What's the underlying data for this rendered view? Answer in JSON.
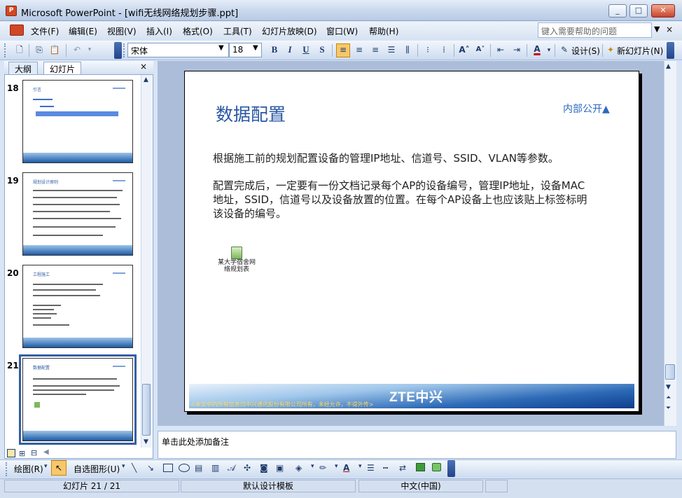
{
  "window": {
    "title": "Microsoft PowerPoint - [wifi无线网络规划步骤.ppt]",
    "minimize": "_",
    "maximize": "□",
    "close": "✕"
  },
  "menu": {
    "items": [
      "文件(F)",
      "编辑(E)",
      "视图(V)",
      "插入(I)",
      "格式(O)",
      "工具(T)",
      "幻灯片放映(D)",
      "窗口(W)",
      "帮助(H)"
    ],
    "help_placeholder": "键入需要帮助的问题",
    "close": "×"
  },
  "toolbar": {
    "font": "宋体",
    "size": "18",
    "bold": "B",
    "italic": "I",
    "underline": "U",
    "shadow": "S",
    "font_color": "A",
    "design_label": "设计(S)",
    "new_slide_label": "新幻灯片(N)"
  },
  "left_pane": {
    "tabs": [
      "大纲",
      "幻灯片"
    ],
    "close": "×",
    "thumbnails": [
      {
        "number": "18",
        "title": "引言"
      },
      {
        "number": "19",
        "title": "规划设计原则"
      },
      {
        "number": "20",
        "title": "工程施工"
      },
      {
        "number": "21",
        "title": "数据配置"
      }
    ]
  },
  "slide": {
    "title": "数据配置",
    "tag": "内部公开▲",
    "paragraph1": "根据施工前的规划配置设备的管理IP地址、信道号、SSID、VLAN等参数。",
    "paragraph2": "配置完成后，一定要有一份文档记录每个AP的设备编号，管理IP地址，设备MAC地址，SSID，信道号以及设备放置的位置。在每个AP设备上也应该贴上标签标明该设备的编号。",
    "embed_label": "某大学宿舍网络规划表",
    "logo": "ZTE中兴",
    "footer_note": "<本文中的所有信息归中兴通讯股份有限公司所有，未经允许，不得外传>"
  },
  "notes": {
    "placeholder": "单击此处添加备注"
  },
  "drawbar": {
    "draw_label": "绘图(R)",
    "autoshapes_label": "自选图形(U)"
  },
  "status": {
    "slide_info": "幻灯片 21 / 21",
    "template": "默认设计模板",
    "language": "中文(中国)"
  },
  "colors": {
    "title_blue": "#2a57a4",
    "tag_blue": "#2c68c2",
    "footer_note": "#ffd85a",
    "selected_thumb": "#355ea5"
  }
}
